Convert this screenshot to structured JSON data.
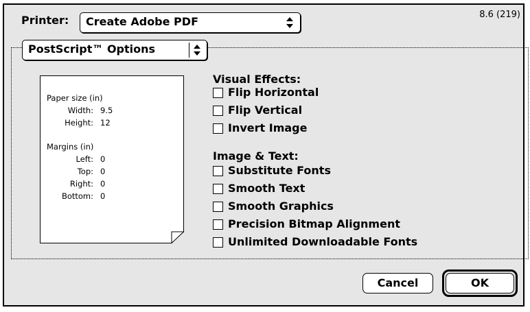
{
  "printer": {
    "label": "Printer:",
    "selected": "Create Adobe PDF"
  },
  "version": "8.6 (219)",
  "section_selector": {
    "selected": "PostScript™ Options"
  },
  "paper_preview": {
    "paper_size_heading": "Paper size (in)",
    "width_label": "Width:",
    "width_value": "9.5",
    "height_label": "Height:",
    "height_value": "12",
    "margins_heading": "Margins (in)",
    "left_label": "Left:",
    "left_value": "0",
    "top_label": "Top:",
    "top_value": "0",
    "right_label": "Right:",
    "right_value": "0",
    "bottom_label": "Bottom:",
    "bottom_value": "0"
  },
  "visual_effects": {
    "title": "Visual Effects:",
    "options": [
      {
        "label": "Flip Horizontal",
        "checked": false
      },
      {
        "label": "Flip Vertical",
        "checked": false
      },
      {
        "label": "Invert Image",
        "checked": false
      }
    ]
  },
  "image_text": {
    "title": "Image & Text:",
    "options": [
      {
        "label": "Substitute Fonts",
        "checked": false
      },
      {
        "label": "Smooth Text",
        "checked": false
      },
      {
        "label": "Smooth Graphics",
        "checked": false
      },
      {
        "label": "Precision Bitmap Alignment",
        "checked": false
      },
      {
        "label": "Unlimited Downloadable Fonts",
        "checked": false
      }
    ]
  },
  "buttons": {
    "cancel": "Cancel",
    "ok": "OK"
  }
}
